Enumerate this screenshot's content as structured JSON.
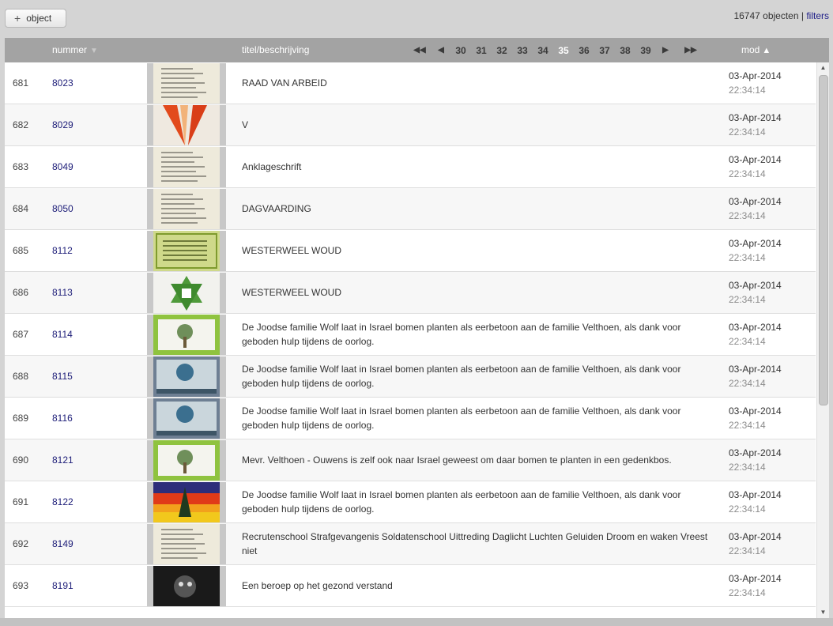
{
  "toolbar": {
    "add_label": "object",
    "add_icon": "plus-icon"
  },
  "status": {
    "count": "16747 objecten",
    "separator": "|",
    "filters": "filters"
  },
  "table": {
    "headers": {
      "nummer": "nummer",
      "titel": "titel/beschrijving",
      "mod": "mod"
    },
    "pager": {
      "first": "◀◀",
      "prev": "◀",
      "pages": [
        "30",
        "31",
        "32",
        "33",
        "34",
        "35",
        "36",
        "37",
        "38",
        "39"
      ],
      "current": "35",
      "next": "▶",
      "last": "▶▶"
    },
    "rows": [
      {
        "idx": "681",
        "num": "8023",
        "desc": "RAAD VAN ARBEID",
        "date": "03-Apr-2014",
        "time": "22:34:14",
        "thumb": "document"
      },
      {
        "idx": "682",
        "num": "8029",
        "desc": "V",
        "date": "03-Apr-2014",
        "time": "22:34:14",
        "thumb": "poster-orange"
      },
      {
        "idx": "683",
        "num": "8049",
        "desc": "Anklageschrift",
        "date": "03-Apr-2014",
        "time": "22:34:14",
        "thumb": "document"
      },
      {
        "idx": "684",
        "num": "8050",
        "desc": "DAGVAARDING",
        "date": "03-Apr-2014",
        "time": "22:34:14",
        "thumb": "document"
      },
      {
        "idx": "685",
        "num": "8112",
        "desc": "WESTERWEEL WOUD",
        "date": "03-Apr-2014",
        "time": "22:34:14",
        "thumb": "certificate-green"
      },
      {
        "idx": "686",
        "num": "8113",
        "desc": "WESTERWEEL WOUD",
        "date": "03-Apr-2014",
        "time": "22:34:14",
        "thumb": "star-menorah"
      },
      {
        "idx": "687",
        "num": "8114",
        "desc": "De Joodse familie Wolf laat in Israel bomen planten als eerbetoon aan de familie Velthoen, als dank voor geboden hulp tijdens de oorlog.",
        "date": "03-Apr-2014",
        "time": "22:34:14",
        "thumb": "tree-green"
      },
      {
        "idx": "688",
        "num": "8115",
        "desc": "De Joodse familie Wolf laat in Israel bomen planten als eerbetoon aan de familie Velthoen, als dank voor geboden hulp tijdens de oorlog.",
        "date": "03-Apr-2014",
        "time": "22:34:14",
        "thumb": "tree-blue"
      },
      {
        "idx": "689",
        "num": "8116",
        "desc": "De Joodse familie Wolf laat in Israel bomen planten als eerbetoon aan de familie Velthoen, als dank voor geboden hulp tijdens de oorlog.",
        "date": "03-Apr-2014",
        "time": "22:34:14",
        "thumb": "tree-blue"
      },
      {
        "idx": "690",
        "num": "8121",
        "desc": "Mevr. Velthoen - Ouwens is zelf ook naar Israel geweest om daar bomen te planten in een gedenkbos.",
        "date": "03-Apr-2014",
        "time": "22:34:14",
        "thumb": "tree-green"
      },
      {
        "idx": "691",
        "num": "8122",
        "desc": "De Joodse familie Wolf laat in Israel bomen planten als eerbetoon aan de familie Velthoen, als dank voor geboden hulp tijdens de oorlog.",
        "date": "03-Apr-2014",
        "time": "22:34:14",
        "thumb": "sunset-tree"
      },
      {
        "idx": "692",
        "num": "8149",
        "desc": "Recrutenschool Strafgevangenis Soldatenschool Uittreding Daglicht Luchten Geluiden Droom en waken Vreest niet",
        "date": "03-Apr-2014",
        "time": "22:34:14",
        "thumb": "document"
      },
      {
        "idx": "693",
        "num": "8191",
        "desc": "Een beroep op het gezond verstand",
        "date": "03-Apr-2014",
        "time": "22:34:14",
        "thumb": "dark-poster"
      }
    ]
  }
}
